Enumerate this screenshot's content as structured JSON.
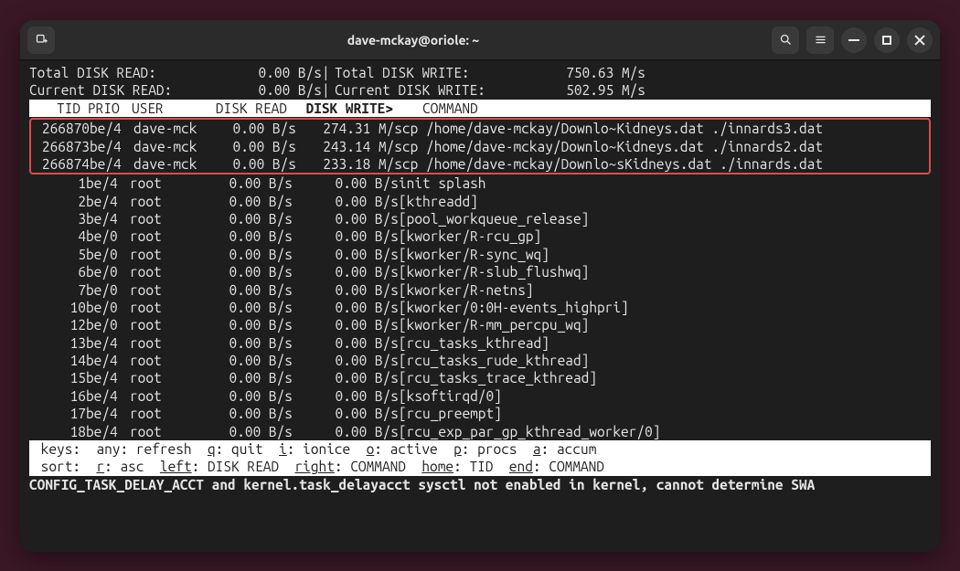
{
  "window": {
    "title": "dave-mckay@oriole: ~"
  },
  "summary": {
    "total_read_label": "Total DISK READ:",
    "total_read_value": "0.00 B/s",
    "total_write_label": "Total DISK WRITE:",
    "total_write_value": "750.63 M/s",
    "current_read_label": "Current DISK READ:",
    "current_read_value": "0.00 B/s",
    "current_write_label": "Current DISK WRITE:",
    "current_write_value": "502.95 M/s",
    "separator": "|"
  },
  "header": {
    "tid": "TID",
    "prio": "PRIO",
    "user": "USER",
    "disk_read": "DISK READ",
    "disk_write": "DISK WRITE>",
    "command": "COMMAND"
  },
  "processes_top": [
    {
      "tid": "266870",
      "prio": "be/4",
      "user": "dave-mck",
      "dr": "0.00 B/s",
      "dw": "274.31 M/s",
      "cmd": "cp /home/dave-mckay/Downlo~Kidneys.dat ./innards3.dat"
    },
    {
      "tid": "266873",
      "prio": "be/4",
      "user": "dave-mck",
      "dr": "0.00 B/s",
      "dw": "243.14 M/s",
      "cmd": "cp /home/dave-mckay/Downlo~Kidneys.dat ./innards2.dat"
    },
    {
      "tid": "266874",
      "prio": "be/4",
      "user": "dave-mck",
      "dr": "0.00 B/s",
      "dw": "233.18 M/s",
      "cmd": "cp /home/dave-mckay/Downlo~sKidneys.dat ./innards.dat"
    }
  ],
  "processes_rest": [
    {
      "tid": "1",
      "prio": "be/4",
      "user": "root",
      "dr": "0.00 B/s",
      "dw": "0.00 B/s",
      "cmd": "init splash"
    },
    {
      "tid": "2",
      "prio": "be/4",
      "user": "root",
      "dr": "0.00 B/s",
      "dw": "0.00 B/s",
      "cmd": "[kthreadd]"
    },
    {
      "tid": "3",
      "prio": "be/4",
      "user": "root",
      "dr": "0.00 B/s",
      "dw": "0.00 B/s",
      "cmd": "[pool_workqueue_release]"
    },
    {
      "tid": "4",
      "prio": "be/0",
      "user": "root",
      "dr": "0.00 B/s",
      "dw": "0.00 B/s",
      "cmd": "[kworker/R-rcu_gp]"
    },
    {
      "tid": "5",
      "prio": "be/0",
      "user": "root",
      "dr": "0.00 B/s",
      "dw": "0.00 B/s",
      "cmd": "[kworker/R-sync_wq]"
    },
    {
      "tid": "6",
      "prio": "be/0",
      "user": "root",
      "dr": "0.00 B/s",
      "dw": "0.00 B/s",
      "cmd": "[kworker/R-slub_flushwq]"
    },
    {
      "tid": "7",
      "prio": "be/0",
      "user": "root",
      "dr": "0.00 B/s",
      "dw": "0.00 B/s",
      "cmd": "[kworker/R-netns]"
    },
    {
      "tid": "10",
      "prio": "be/0",
      "user": "root",
      "dr": "0.00 B/s",
      "dw": "0.00 B/s",
      "cmd": "[kworker/0:0H-events_highpri]"
    },
    {
      "tid": "12",
      "prio": "be/0",
      "user": "root",
      "dr": "0.00 B/s",
      "dw": "0.00 B/s",
      "cmd": "[kworker/R-mm_percpu_wq]"
    },
    {
      "tid": "13",
      "prio": "be/4",
      "user": "root",
      "dr": "0.00 B/s",
      "dw": "0.00 B/s",
      "cmd": "[rcu_tasks_kthread]"
    },
    {
      "tid": "14",
      "prio": "be/4",
      "user": "root",
      "dr": "0.00 B/s",
      "dw": "0.00 B/s",
      "cmd": "[rcu_tasks_rude_kthread]"
    },
    {
      "tid": "15",
      "prio": "be/4",
      "user": "root",
      "dr": "0.00 B/s",
      "dw": "0.00 B/s",
      "cmd": "[rcu_tasks_trace_kthread]"
    },
    {
      "tid": "16",
      "prio": "be/4",
      "user": "root",
      "dr": "0.00 B/s",
      "dw": "0.00 B/s",
      "cmd": "[ksoftirqd/0]"
    },
    {
      "tid": "17",
      "prio": "be/4",
      "user": "root",
      "dr": "0.00 B/s",
      "dw": "0.00 B/s",
      "cmd": "[rcu_preempt]"
    },
    {
      "tid": "18",
      "prio": "be/4",
      "user": "root",
      "dr": "0.00 B/s",
      "dw": "0.00 B/s",
      "cmd": "[rcu_exp_par_gp_kthread_worker/0]"
    }
  ],
  "footer": {
    "keys_line_plain": " keys:  any: refresh  ",
    "q": "q",
    "q_after": ": quit  ",
    "i": "i",
    "i_after": ": ionice  ",
    "o": "o",
    "o_after": ": active  ",
    "p": "p",
    "p_after": ": procs  ",
    "a": "a",
    "a_after": ": accum",
    "sort_line_plain": " sort:  ",
    "r": "r",
    "r_after": ": asc  ",
    "left": "left",
    "left_after": ": DISK READ  ",
    "right": "right",
    "right_after": ": COMMAND  ",
    "home": "home",
    "home_after": ": TID  ",
    "end": "end",
    "end_after": ": COMMAND"
  },
  "warning": "CONFIG_TASK_DELAY_ACCT and kernel.task_delayacct sysctl not enabled in kernel, cannot determine SWA"
}
